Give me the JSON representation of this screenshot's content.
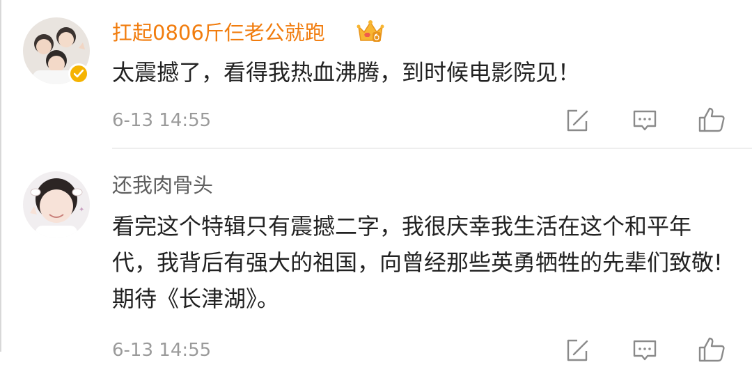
{
  "comments": [
    {
      "username": "扛起0806斤仨老公就跑",
      "badge": "crown-level-6-icon",
      "verified": true,
      "text": "太震撼了，看得我热血沸腾，到时候电影院见！",
      "time": "6-13 14:55"
    },
    {
      "username": "还我肉骨头",
      "verified": false,
      "text": "看完这个特辑只有震撼二字，我很庆幸我生活在这个和平年代，我背后有强大的祖国，向曾经那些英勇牺牲的先辈们致敬!期待《长津湖》。",
      "time": "6-13 14:55"
    }
  ],
  "actions": [
    "share-icon",
    "comment-icon",
    "like-icon"
  ],
  "colors": {
    "vip_username": "#f17c0d",
    "username": "#5f5f5f",
    "text": "#222222",
    "time": "#9a9a9a",
    "icon": "#8a8a8a",
    "verified_badge": "#f5b301"
  }
}
